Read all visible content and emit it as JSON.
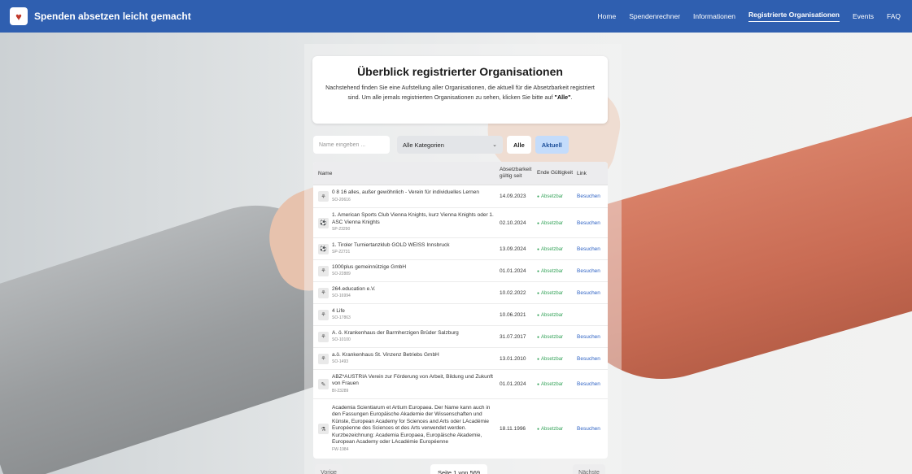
{
  "app": {
    "brand": "Spenden absetzen leicht gemacht",
    "logo_icon": "heart-hands-icon"
  },
  "nav": {
    "items": [
      {
        "label": "Home"
      },
      {
        "label": "Spendenrechner"
      },
      {
        "label": "Informationen"
      },
      {
        "label": "Registrierte Organisationen",
        "active": true
      },
      {
        "label": "Events"
      },
      {
        "label": "FAQ"
      }
    ]
  },
  "hero": {
    "title": "Überblick registrierter Organisationen",
    "description_pre": "Nachstehend finden Sie eine Aufstellung aller Organisationen, die aktuell für die Absetzbarkeit registriert sind. Um alle jemals registrierten Organisationen zu sehen, klicken Sie bitte auf ",
    "description_bold": "\"Alle\"",
    "description_post": "."
  },
  "filters": {
    "search_placeholder": "Name eingeben ...",
    "category_value": "Alle Kategorien",
    "btn_all": "Alle",
    "btn_current": "Aktuell"
  },
  "table": {
    "headers": {
      "name": "Name",
      "since": "Absetzbarkeit gültig seit",
      "end": "Ende Gültigkeit",
      "link": "Link"
    },
    "rows": [
      {
        "icon": "organization-icon",
        "name": "0 8 16 alles, außer gewöhnlich - Verein für individuelles Lernen",
        "id": "SO-20616",
        "since": "14.09.2023",
        "status": "Absetzbar",
        "link": "Besuchen"
      },
      {
        "icon": "sports-icon",
        "name": "1. American Sports Club Vienna Knights, kurz Vienna Knights oder 1. ASC Vienna Knights",
        "id": "SP-23290",
        "since": "02.10.2024",
        "status": "Absetzbar",
        "link": "Besuchen"
      },
      {
        "icon": "sports-icon",
        "name": "1. Tiroler Turniertanzklub GOLD WEISS Innsbruck",
        "id": "SP-22731",
        "since": "13.09.2024",
        "status": "Absetzbar",
        "link": "Besuchen"
      },
      {
        "icon": "organization-icon",
        "name": "1000plus gemeinnützige GmbH",
        "id": "SO-22889",
        "since": "01.01.2024",
        "status": "Absetzbar",
        "link": "Besuchen"
      },
      {
        "icon": "organization-icon",
        "name": "264.education e.V.",
        "id": "SO-16994",
        "since": "10.02.2022",
        "status": "Absetzbar",
        "link": "Besuchen"
      },
      {
        "icon": "organization-icon",
        "name": "4 Life",
        "id": "SO-17863",
        "since": "10.06.2021",
        "status": "Absetzbar",
        "link": ""
      },
      {
        "icon": "organization-icon",
        "name": "A. ö. Krankenhaus der Barmherzigen Brüder Salzburg",
        "id": "SO-10100",
        "since": "31.07.2017",
        "status": "Absetzbar",
        "link": "Besuchen"
      },
      {
        "icon": "organization-icon",
        "name": "a.ö. Krankenhaus St. Vinzenz Betriebs GmbH",
        "id": "SO-1493",
        "since": "13.01.2010",
        "status": "Absetzbar",
        "link": "Besuchen"
      },
      {
        "icon": "education-icon",
        "name": "ABZ*AUSTRIA Verein zur Förderung von Arbeit, Bildung und Zukunft von Frauen",
        "id": "BI-23289",
        "since": "01.01.2024",
        "status": "Absetzbar",
        "link": "Besuchen"
      },
      {
        "icon": "research-icon",
        "name": "Academia Scientiarum et Artium Europaea. Der Name kann auch in den Fassungen Europäische Akademie der Wissenschaften und Künste, European Academy for Sciences and Arts oder LAcadémie Européenne des Sciences et des Arts verwendet werden. Kurzbezeichnung: Academia Europaea, Europäische Akademie, European Academy oder LAcadémie Européenne",
        "id": "FW-1984",
        "since": "18.11.1996",
        "status": "Absetzbar",
        "link": "Besuchen"
      }
    ]
  },
  "pagination": {
    "prev": "Vorige",
    "info": "Seite 1 von 569",
    "next": "Nächste"
  }
}
